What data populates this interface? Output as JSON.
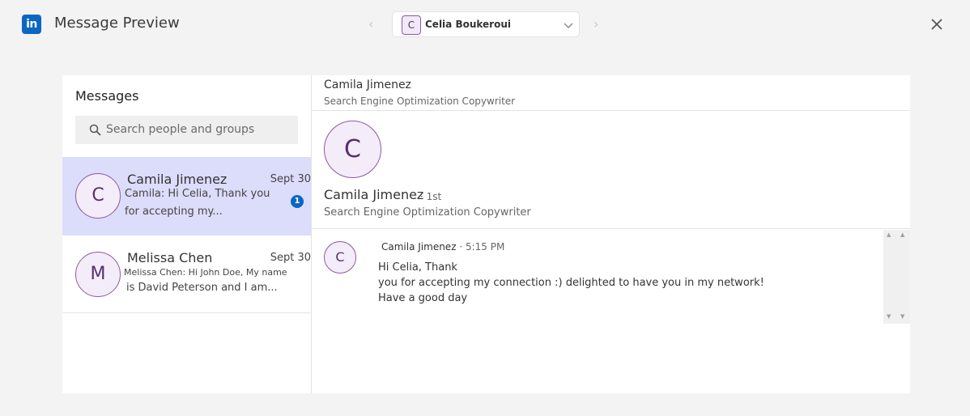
{
  "header": {
    "logo": "in",
    "title": "Message Preview",
    "account": {
      "avatar_letter": "C",
      "name": "Celia Boukeroui"
    }
  },
  "inbox": {
    "title": "Messages",
    "search_placeholder": "Search people and groups",
    "conversations": [
      {
        "avatar_letter": "C",
        "name": "Camila Jimenez",
        "date": "Sept 30",
        "preview_line1": "Camila: Hi Celia, Thank you",
        "preview_line2": "for accepting my...",
        "unread": "1"
      },
      {
        "avatar_letter": "M",
        "name": "Melissa Chen",
        "date": "Sept 30",
        "preview_line1": "Melissa Chen: Hi John Doe, My name",
        "preview_line2": "is David Peterson and I am..."
      }
    ]
  },
  "thread": {
    "name": "Camila Jimenez",
    "subtitle": "Search Engine Optimization Copywriter",
    "profile": {
      "avatar_letter": "C",
      "name": "Camila Jimenez",
      "degree": "· 1st",
      "title": "Search Engine Optimization Copywriter"
    },
    "message": {
      "avatar_letter": "C",
      "sender": "Camila Jimenez",
      "time": " · 5:15 PM",
      "line1": "Hi Celia, Thank",
      "line2": "you for accepting my connection :) delighted to have you in my network! Have a good day"
    }
  },
  "colors": {
    "brand": "#0a66c2",
    "active_row": "#dcdcfb",
    "avatar_border": "#8a5b9e"
  }
}
